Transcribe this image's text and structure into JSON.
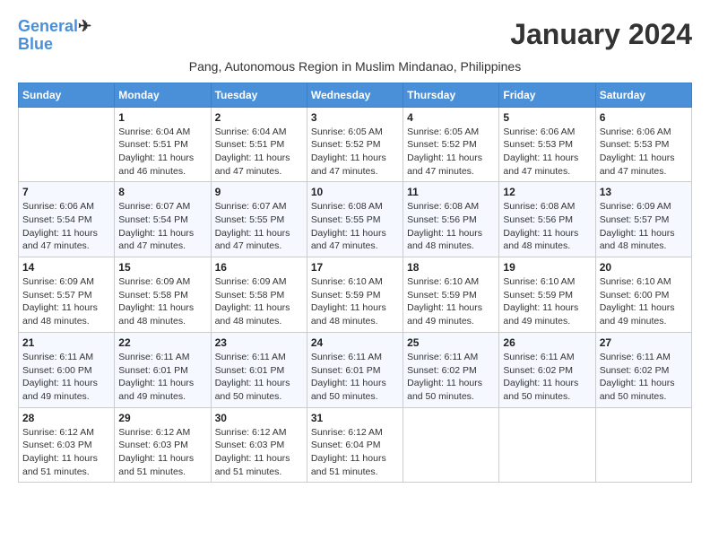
{
  "header": {
    "logo_line1": "General",
    "logo_line2": "Blue",
    "month_title": "January 2024",
    "subtitle": "Pang, Autonomous Region in Muslim Mindanao, Philippines"
  },
  "weekdays": [
    "Sunday",
    "Monday",
    "Tuesday",
    "Wednesday",
    "Thursday",
    "Friday",
    "Saturday"
  ],
  "weeks": [
    [
      {
        "day": "",
        "sunrise": "",
        "sunset": "",
        "daylight": ""
      },
      {
        "day": "1",
        "sunrise": "Sunrise: 6:04 AM",
        "sunset": "Sunset: 5:51 PM",
        "daylight": "Daylight: 11 hours and 46 minutes."
      },
      {
        "day": "2",
        "sunrise": "Sunrise: 6:04 AM",
        "sunset": "Sunset: 5:51 PM",
        "daylight": "Daylight: 11 hours and 47 minutes."
      },
      {
        "day": "3",
        "sunrise": "Sunrise: 6:05 AM",
        "sunset": "Sunset: 5:52 PM",
        "daylight": "Daylight: 11 hours and 47 minutes."
      },
      {
        "day": "4",
        "sunrise": "Sunrise: 6:05 AM",
        "sunset": "Sunset: 5:52 PM",
        "daylight": "Daylight: 11 hours and 47 minutes."
      },
      {
        "day": "5",
        "sunrise": "Sunrise: 6:06 AM",
        "sunset": "Sunset: 5:53 PM",
        "daylight": "Daylight: 11 hours and 47 minutes."
      },
      {
        "day": "6",
        "sunrise": "Sunrise: 6:06 AM",
        "sunset": "Sunset: 5:53 PM",
        "daylight": "Daylight: 11 hours and 47 minutes."
      }
    ],
    [
      {
        "day": "7",
        "sunrise": "Sunrise: 6:06 AM",
        "sunset": "Sunset: 5:54 PM",
        "daylight": "Daylight: 11 hours and 47 minutes."
      },
      {
        "day": "8",
        "sunrise": "Sunrise: 6:07 AM",
        "sunset": "Sunset: 5:54 PM",
        "daylight": "Daylight: 11 hours and 47 minutes."
      },
      {
        "day": "9",
        "sunrise": "Sunrise: 6:07 AM",
        "sunset": "Sunset: 5:55 PM",
        "daylight": "Daylight: 11 hours and 47 minutes."
      },
      {
        "day": "10",
        "sunrise": "Sunrise: 6:08 AM",
        "sunset": "Sunset: 5:55 PM",
        "daylight": "Daylight: 11 hours and 47 minutes."
      },
      {
        "day": "11",
        "sunrise": "Sunrise: 6:08 AM",
        "sunset": "Sunset: 5:56 PM",
        "daylight": "Daylight: 11 hours and 48 minutes."
      },
      {
        "day": "12",
        "sunrise": "Sunrise: 6:08 AM",
        "sunset": "Sunset: 5:56 PM",
        "daylight": "Daylight: 11 hours and 48 minutes."
      },
      {
        "day": "13",
        "sunrise": "Sunrise: 6:09 AM",
        "sunset": "Sunset: 5:57 PM",
        "daylight": "Daylight: 11 hours and 48 minutes."
      }
    ],
    [
      {
        "day": "14",
        "sunrise": "Sunrise: 6:09 AM",
        "sunset": "Sunset: 5:57 PM",
        "daylight": "Daylight: 11 hours and 48 minutes."
      },
      {
        "day": "15",
        "sunrise": "Sunrise: 6:09 AM",
        "sunset": "Sunset: 5:58 PM",
        "daylight": "Daylight: 11 hours and 48 minutes."
      },
      {
        "day": "16",
        "sunrise": "Sunrise: 6:09 AM",
        "sunset": "Sunset: 5:58 PM",
        "daylight": "Daylight: 11 hours and 48 minutes."
      },
      {
        "day": "17",
        "sunrise": "Sunrise: 6:10 AM",
        "sunset": "Sunset: 5:59 PM",
        "daylight": "Daylight: 11 hours and 48 minutes."
      },
      {
        "day": "18",
        "sunrise": "Sunrise: 6:10 AM",
        "sunset": "Sunset: 5:59 PM",
        "daylight": "Daylight: 11 hours and 49 minutes."
      },
      {
        "day": "19",
        "sunrise": "Sunrise: 6:10 AM",
        "sunset": "Sunset: 5:59 PM",
        "daylight": "Daylight: 11 hours and 49 minutes."
      },
      {
        "day": "20",
        "sunrise": "Sunrise: 6:10 AM",
        "sunset": "Sunset: 6:00 PM",
        "daylight": "Daylight: 11 hours and 49 minutes."
      }
    ],
    [
      {
        "day": "21",
        "sunrise": "Sunrise: 6:11 AM",
        "sunset": "Sunset: 6:00 PM",
        "daylight": "Daylight: 11 hours and 49 minutes."
      },
      {
        "day": "22",
        "sunrise": "Sunrise: 6:11 AM",
        "sunset": "Sunset: 6:01 PM",
        "daylight": "Daylight: 11 hours and 49 minutes."
      },
      {
        "day": "23",
        "sunrise": "Sunrise: 6:11 AM",
        "sunset": "Sunset: 6:01 PM",
        "daylight": "Daylight: 11 hours and 50 minutes."
      },
      {
        "day": "24",
        "sunrise": "Sunrise: 6:11 AM",
        "sunset": "Sunset: 6:01 PM",
        "daylight": "Daylight: 11 hours and 50 minutes."
      },
      {
        "day": "25",
        "sunrise": "Sunrise: 6:11 AM",
        "sunset": "Sunset: 6:02 PM",
        "daylight": "Daylight: 11 hours and 50 minutes."
      },
      {
        "day": "26",
        "sunrise": "Sunrise: 6:11 AM",
        "sunset": "Sunset: 6:02 PM",
        "daylight": "Daylight: 11 hours and 50 minutes."
      },
      {
        "day": "27",
        "sunrise": "Sunrise: 6:11 AM",
        "sunset": "Sunset: 6:02 PM",
        "daylight": "Daylight: 11 hours and 50 minutes."
      }
    ],
    [
      {
        "day": "28",
        "sunrise": "Sunrise: 6:12 AM",
        "sunset": "Sunset: 6:03 PM",
        "daylight": "Daylight: 11 hours and 51 minutes."
      },
      {
        "day": "29",
        "sunrise": "Sunrise: 6:12 AM",
        "sunset": "Sunset: 6:03 PM",
        "daylight": "Daylight: 11 hours and 51 minutes."
      },
      {
        "day": "30",
        "sunrise": "Sunrise: 6:12 AM",
        "sunset": "Sunset: 6:03 PM",
        "daylight": "Daylight: 11 hours and 51 minutes."
      },
      {
        "day": "31",
        "sunrise": "Sunrise: 6:12 AM",
        "sunset": "Sunset: 6:04 PM",
        "daylight": "Daylight: 11 hours and 51 minutes."
      },
      {
        "day": "",
        "sunrise": "",
        "sunset": "",
        "daylight": ""
      },
      {
        "day": "",
        "sunrise": "",
        "sunset": "",
        "daylight": ""
      },
      {
        "day": "",
        "sunrise": "",
        "sunset": "",
        "daylight": ""
      }
    ]
  ]
}
